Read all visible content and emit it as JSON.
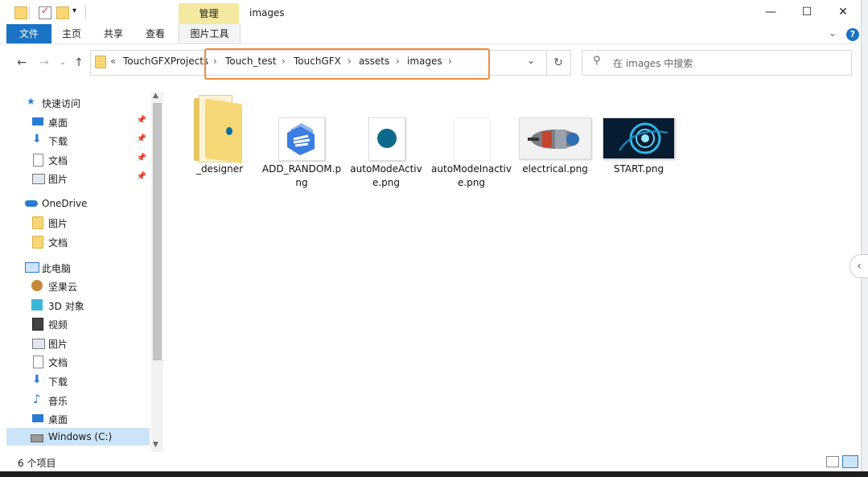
{
  "window": {
    "title": "images",
    "context_tab": "管理",
    "minimize": "—",
    "maximize": "☐",
    "close": "✕"
  },
  "ribbon": {
    "tabs": [
      "文件",
      "主页",
      "共享",
      "查看",
      "图片工具"
    ],
    "expand": "⌄",
    "help": "?"
  },
  "address": {
    "overflow": "«",
    "crumbs": [
      "TouchGFXProjects",
      "Touch_test",
      "TouchGFX",
      "assets",
      "images"
    ],
    "dropdown": "⌄",
    "refresh": "↻"
  },
  "search": {
    "placeholder": "在 images 中搜索"
  },
  "nav": {
    "quick_access": "快速访问",
    "quick_items": [
      "桌面",
      "下载",
      "文档",
      "图片"
    ],
    "onedrive": "OneDrive",
    "onedrive_items": [
      "图片",
      "文档"
    ],
    "this_pc": "此电脑",
    "pc_items": [
      "坚果云",
      "3D 对象",
      "视频",
      "图片",
      "文档",
      "下载",
      "音乐",
      "桌面",
      "Windows (C:)"
    ]
  },
  "files": [
    {
      "name": "_designer",
      "type": "folder"
    },
    {
      "name": "ADD_RANDOM.png",
      "type": "image"
    },
    {
      "name": "autoModeActive.png",
      "type": "image"
    },
    {
      "name": "autoModeInactive.png",
      "type": "image"
    },
    {
      "name": "electrical.png",
      "type": "image"
    },
    {
      "name": "START.png",
      "type": "image"
    }
  ],
  "status": {
    "count": "6 个项目"
  },
  "colors": {
    "accent": "#1a73c4",
    "highlight": "#f08a3c",
    "manage_tab": "#f4e9a0"
  }
}
